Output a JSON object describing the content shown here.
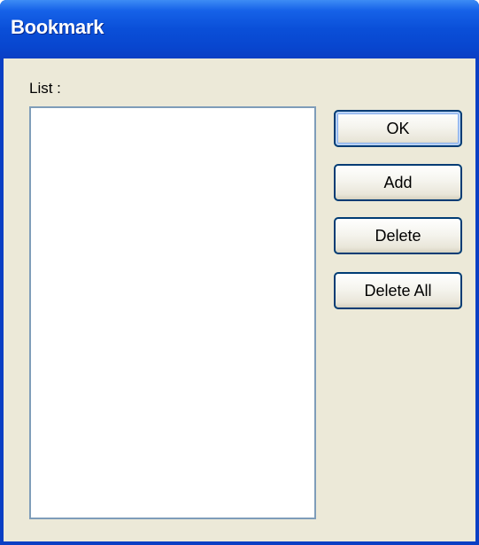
{
  "window": {
    "title": "Bookmark"
  },
  "list": {
    "label": "List :",
    "items": []
  },
  "buttons": {
    "ok": "OK",
    "add": "Add",
    "delete": "Delete",
    "delete_all": "Delete All"
  },
  "colors": {
    "titlebar": "#0a4fd8",
    "dialog_bg": "#ece9d8",
    "button_border": "#003c74",
    "listbox_border": "#7f9db9"
  }
}
